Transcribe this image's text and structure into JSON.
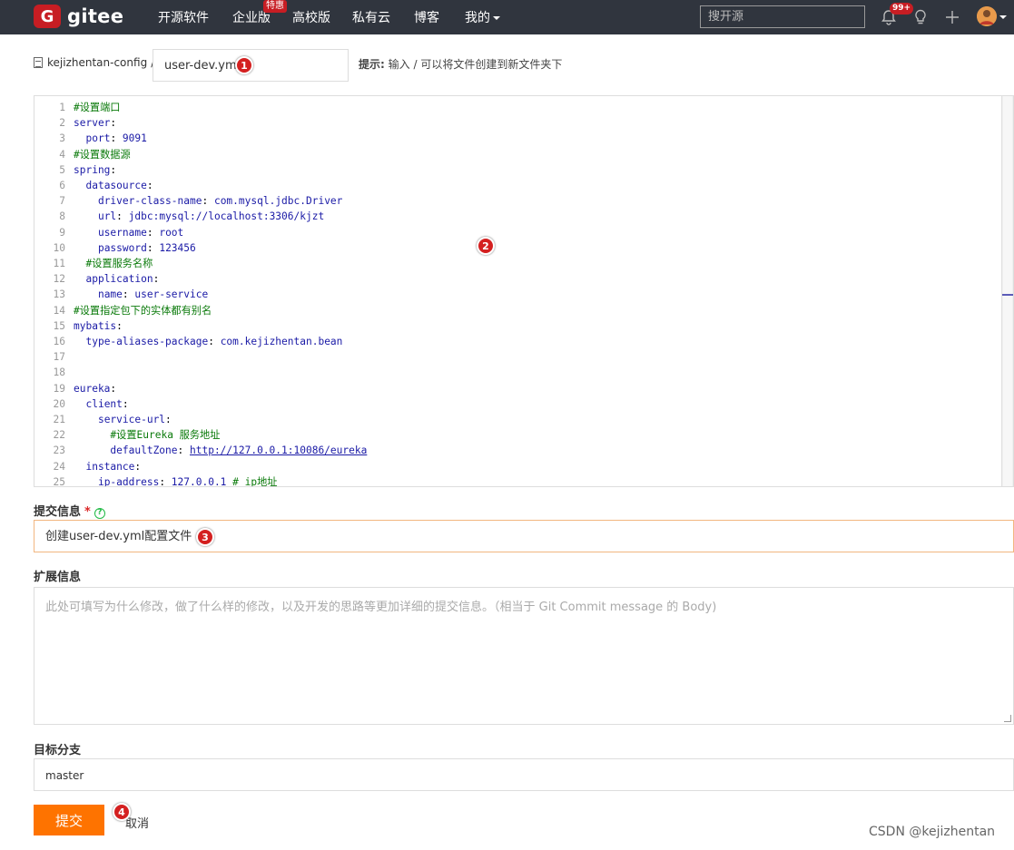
{
  "nav": {
    "brand": "gitee",
    "items": [
      {
        "label": "开源软件"
      },
      {
        "label": "企业版"
      },
      {
        "label": "高校版"
      },
      {
        "label": "私有云"
      },
      {
        "label": "博客"
      },
      {
        "label": "我的"
      }
    ],
    "hot_badge": "特惠",
    "search_placeholder": "搜开源",
    "notification_count": "99+"
  },
  "breadcrumb": {
    "repo": "kejizhentan-config",
    "separator": "/"
  },
  "file_name": {
    "value": "user-dev.yml"
  },
  "hint": {
    "label": "提示:",
    "text": "输入 / 可以将文件创建到新文件夹下"
  },
  "editor": {
    "lines": [
      {
        "n": "1",
        "segments": [
          [
            "c",
            "#设置端口"
          ]
        ]
      },
      {
        "n": "2",
        "segments": [
          [
            "k",
            "server"
          ],
          [
            "p",
            ":"
          ]
        ]
      },
      {
        "n": "3",
        "segments": [
          [
            "p",
            "  "
          ],
          [
            "k",
            "port"
          ],
          [
            "p",
            ": "
          ],
          [
            "v",
            "9091"
          ]
        ]
      },
      {
        "n": "4",
        "segments": [
          [
            "c",
            "#设置数据源"
          ]
        ]
      },
      {
        "n": "5",
        "segments": [
          [
            "k",
            "spring"
          ],
          [
            "p",
            ":"
          ]
        ]
      },
      {
        "n": "6",
        "segments": [
          [
            "p",
            "  "
          ],
          [
            "k",
            "datasource"
          ],
          [
            "p",
            ":"
          ]
        ]
      },
      {
        "n": "7",
        "segments": [
          [
            "p",
            "    "
          ],
          [
            "k",
            "driver-class-name"
          ],
          [
            "p",
            ": "
          ],
          [
            "v",
            "com.mysql.jdbc.Driver"
          ]
        ]
      },
      {
        "n": "8",
        "segments": [
          [
            "p",
            "    "
          ],
          [
            "k",
            "url"
          ],
          [
            "p",
            ": "
          ],
          [
            "v",
            "jdbc:mysql://localhost:3306/kjzt"
          ]
        ]
      },
      {
        "n": "9",
        "segments": [
          [
            "p",
            "    "
          ],
          [
            "k",
            "username"
          ],
          [
            "p",
            ": "
          ],
          [
            "v",
            "root"
          ]
        ]
      },
      {
        "n": "10",
        "segments": [
          [
            "p",
            "    "
          ],
          [
            "k",
            "password"
          ],
          [
            "p",
            ": "
          ],
          [
            "v",
            "123456"
          ]
        ]
      },
      {
        "n": "11",
        "segments": [
          [
            "p",
            "  "
          ],
          [
            "c",
            "#设置服务名称"
          ]
        ]
      },
      {
        "n": "12",
        "segments": [
          [
            "p",
            "  "
          ],
          [
            "k",
            "application"
          ],
          [
            "p",
            ":"
          ]
        ]
      },
      {
        "n": "13",
        "segments": [
          [
            "p",
            "    "
          ],
          [
            "k",
            "name"
          ],
          [
            "p",
            ": "
          ],
          [
            "v",
            "user-service"
          ]
        ]
      },
      {
        "n": "14",
        "segments": [
          [
            "c",
            "#设置指定包下的实体都有别名"
          ]
        ]
      },
      {
        "n": "15",
        "segments": [
          [
            "k",
            "mybatis"
          ],
          [
            "p",
            ":"
          ]
        ]
      },
      {
        "n": "16",
        "segments": [
          [
            "p",
            "  "
          ],
          [
            "k",
            "type-aliases-package"
          ],
          [
            "p",
            ": "
          ],
          [
            "v",
            "com.kejizhentan.bean"
          ]
        ]
      },
      {
        "n": "17",
        "segments": []
      },
      {
        "n": "18",
        "segments": []
      },
      {
        "n": "19",
        "segments": [
          [
            "k",
            "eureka"
          ],
          [
            "p",
            ":"
          ]
        ]
      },
      {
        "n": "20",
        "segments": [
          [
            "p",
            "  "
          ],
          [
            "k",
            "client"
          ],
          [
            "p",
            ":"
          ]
        ]
      },
      {
        "n": "21",
        "segments": [
          [
            "p",
            "    "
          ],
          [
            "k",
            "service-url"
          ],
          [
            "p",
            ":"
          ]
        ]
      },
      {
        "n": "22",
        "segments": [
          [
            "p",
            "      "
          ],
          [
            "c",
            "#设置Eureka 服务地址"
          ]
        ]
      },
      {
        "n": "23",
        "segments": [
          [
            "p",
            "      "
          ],
          [
            "k",
            "defaultZone"
          ],
          [
            "p",
            ": "
          ],
          [
            "u",
            "http://127.0.0.1:10086/eureka"
          ]
        ]
      },
      {
        "n": "24",
        "segments": [
          [
            "p",
            "  "
          ],
          [
            "k",
            "instance"
          ],
          [
            "p",
            ":"
          ]
        ]
      },
      {
        "n": "25",
        "segments": [
          [
            "p",
            "    "
          ],
          [
            "k",
            "ip-address"
          ],
          [
            "p",
            ": "
          ],
          [
            "v",
            "127.0.0.1"
          ],
          [
            "p",
            " "
          ],
          [
            "c",
            "# ip地址"
          ]
        ]
      }
    ]
  },
  "commit": {
    "label": "提交信息",
    "required_mark": "*",
    "value": "创建user-dev.yml配置文件"
  },
  "extended": {
    "label": "扩展信息",
    "placeholder": "此处可填写为什么修改，做了什么样的修改，以及开发的思路等更加详细的提交信息。（相当于 Git Commit message 的 Body)"
  },
  "branch": {
    "label": "目标分支",
    "value": "master"
  },
  "actions": {
    "submit": "提交",
    "cancel": "取消"
  },
  "markers": [
    "1",
    "2",
    "3",
    "4"
  ],
  "watermark": "CSDN @kejizhentan",
  "colors": {
    "topbar": "#30353e",
    "brand": "#c71d23",
    "submit": "#fe7300",
    "marker": "#d42020"
  }
}
